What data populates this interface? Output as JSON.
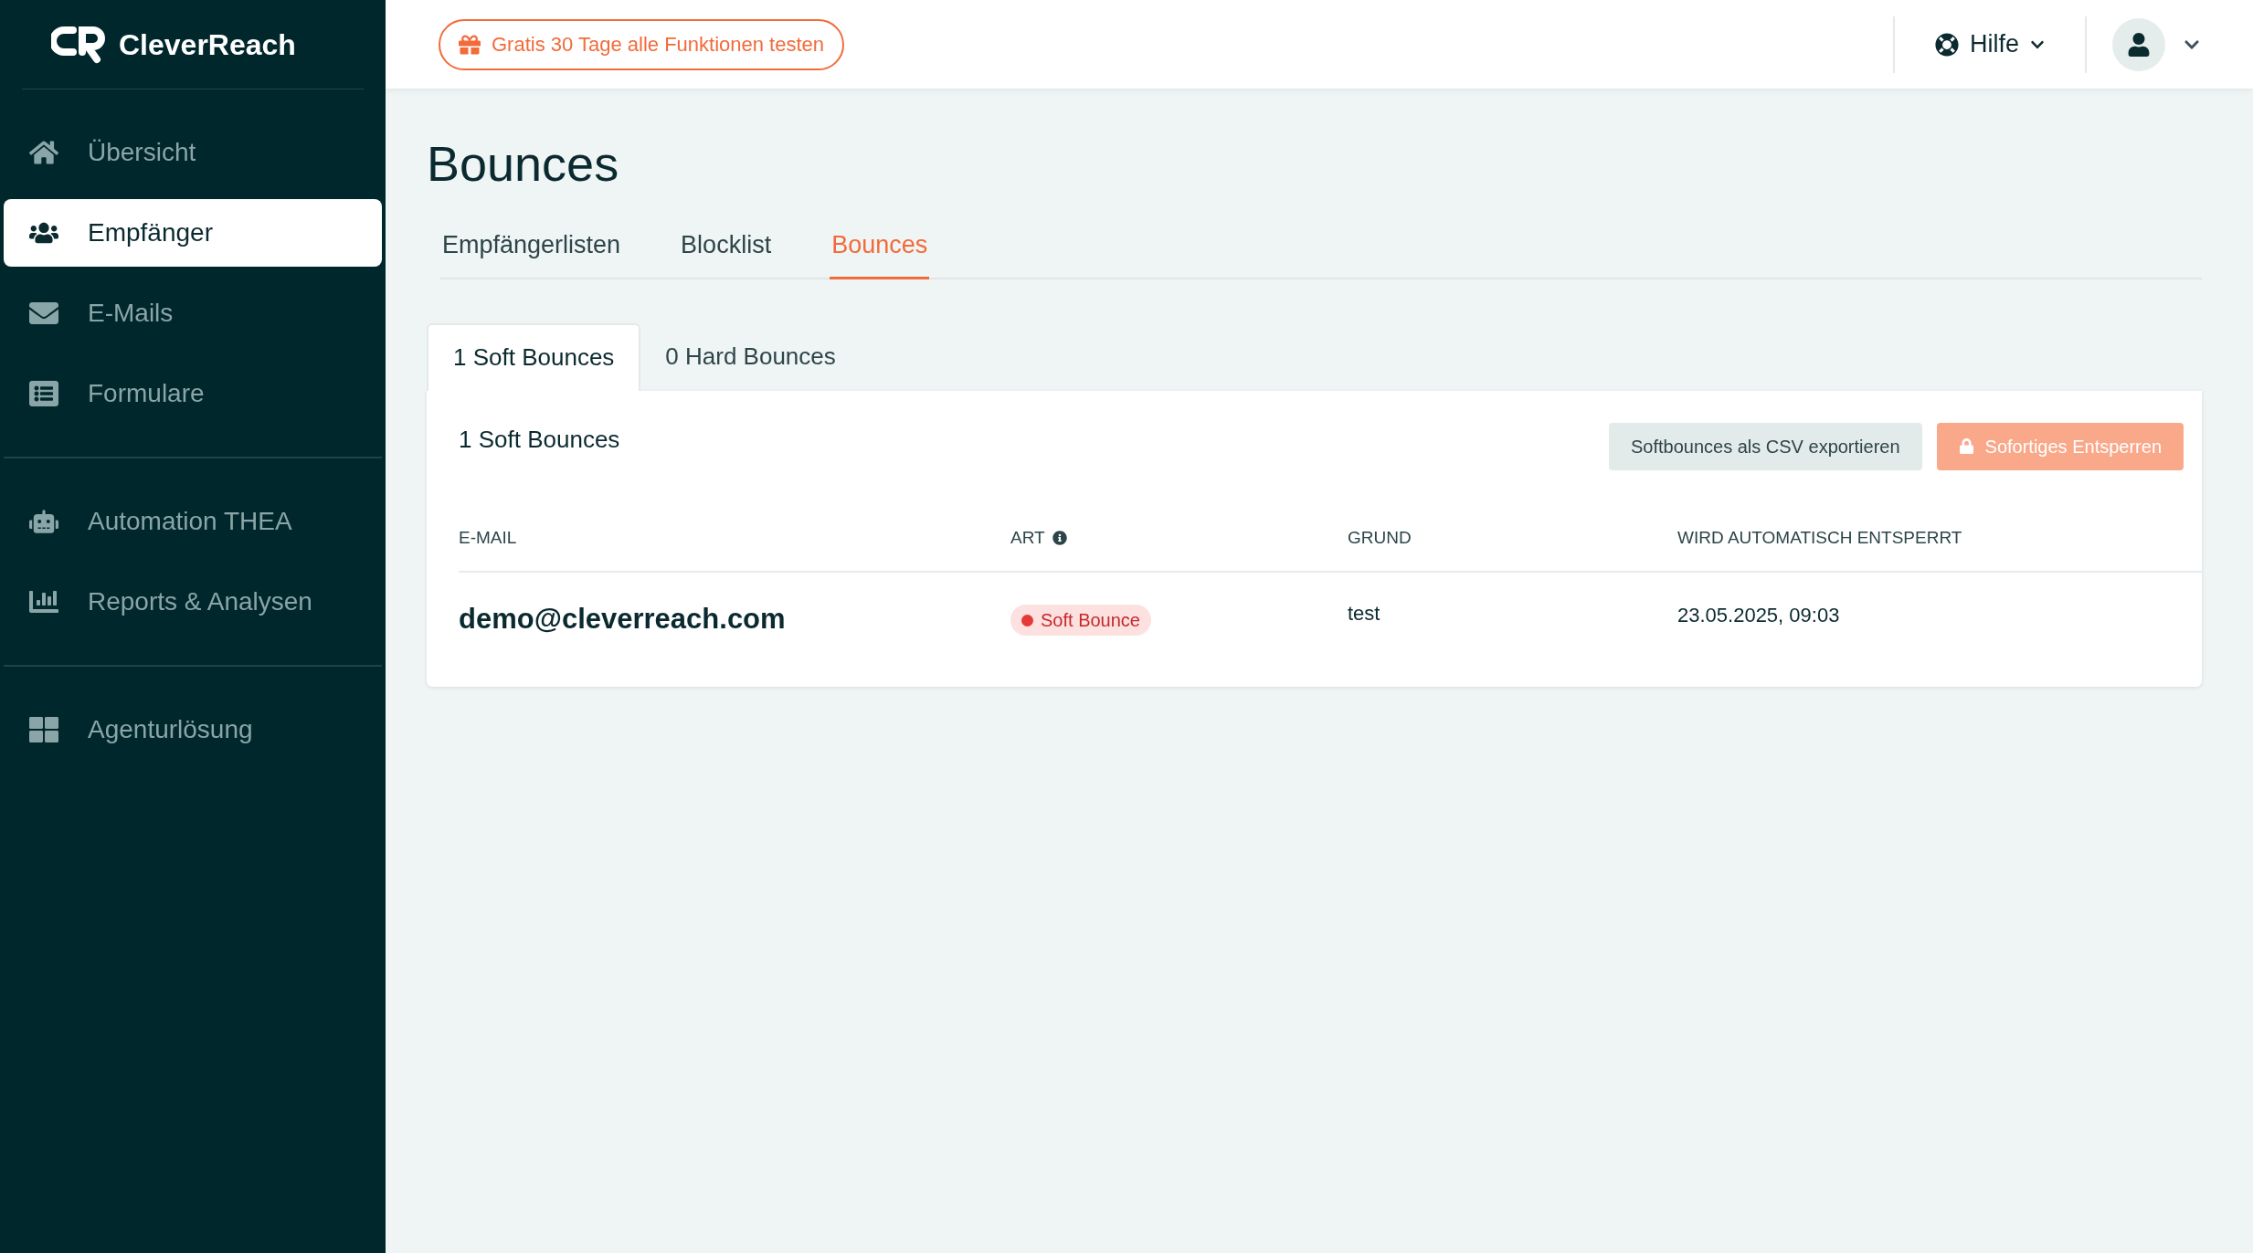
{
  "sidebar": {
    "logo": "CleverReach",
    "groups": [
      [
        {
          "label": "Übersicht",
          "selected": false
        },
        {
          "label": "Empfänger",
          "selected": true
        },
        {
          "label": "E-Mails",
          "selected": false
        },
        {
          "label": "Formulare",
          "selected": false
        }
      ],
      [
        {
          "label": "Automation THEA",
          "selected": false
        },
        {
          "label": "Reports & Analysen",
          "selected": false
        }
      ],
      [
        {
          "label": "Agenturlösung",
          "selected": false
        }
      ]
    ]
  },
  "topbar": {
    "trial_button": "Gratis 30 Tage alle Funktionen testen",
    "help": "Hilfe"
  },
  "page": {
    "title": "Bounces"
  },
  "tabs": [
    {
      "label": "Empfängerlisten",
      "selected": false
    },
    {
      "label": "Blocklist",
      "selected": false
    },
    {
      "label": "Bounces",
      "selected": true
    }
  ],
  "subtabs": [
    {
      "label": "1 Soft Bounces",
      "selected": true
    },
    {
      "label": "0 Hard Bounces",
      "selected": false
    }
  ],
  "card": {
    "title": "1 Soft Bounces",
    "buttons": [
      {
        "label": "Softbounces als CSV exportieren",
        "kind": "secondary",
        "disabled": false
      },
      {
        "label": "Sofortiges Entsperren",
        "kind": "primary",
        "disabled": true
      }
    ]
  },
  "table": {
    "columns": [
      "E-MAIL",
      "ART",
      "GRUND",
      "WIRD AUTOMATISCH ENTSPERRT"
    ],
    "rows": [
      {
        "email": "demo@cleverreach.com",
        "type": "Soft Bounce",
        "color": "#e53935",
        "reason": "test",
        "unblock": "23.05.2025, 09:03"
      }
    ]
  }
}
